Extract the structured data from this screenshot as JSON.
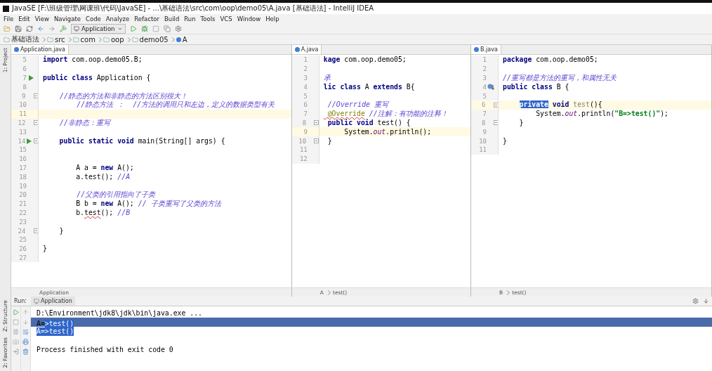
{
  "window": {
    "title": "JavaSE [F:\\班级管理\\网课班\\代码\\JavaSE] - ...\\基础语法\\src\\com\\oop\\demo05\\A.java [基础语法] - IntelliJ IDEA"
  },
  "menu": [
    "File",
    "Edit",
    "View",
    "Navigate",
    "Code",
    "Analyze",
    "Refactor",
    "Build",
    "Run",
    "Tools",
    "VCS",
    "Window",
    "Help"
  ],
  "toolbar": {
    "run_config": "Application"
  },
  "breadcrumb": [
    "基础语法",
    "src",
    "com",
    "oop",
    "demo05",
    "A"
  ],
  "side_tools": {
    "left_top": "1: Project",
    "left_bottom": [
      "Z: Structure",
      "2: Favorites"
    ]
  },
  "editors": [
    {
      "tab": "Application.java",
      "footer": [
        "Application"
      ],
      "lines": [
        {
          "n": "5",
          "current": false,
          "segs": [
            {
              "kind": "kw",
              "text": "import "
            },
            {
              "kind": "text",
              "text": "com.oop.demo05.B;"
            }
          ]
        },
        {
          "n": "6",
          "current": false
        },
        {
          "n": "7",
          "gutter": {
            "kind": "run"
          },
          "current": false,
          "segs": [
            {
              "kind": "kw",
              "text": "public class "
            },
            {
              "kind": "text",
              "text": "Application {"
            }
          ]
        },
        {
          "n": "8",
          "current": false
        },
        {
          "n": "9",
          "gutter": {
            "kind": "fold"
          },
          "current": false,
          "segs": [
            {
              "kind": "comment",
              "text": "    //静态的方法和非静态的方法区别很大！"
            }
          ]
        },
        {
          "n": "10",
          "current": false,
          "segs": [
            {
              "kind": "comment",
              "text": "        //静态方法 ：  //方法的调用只和左边，定义的数据类型有关"
            }
          ]
        },
        {
          "n": "11",
          "current": true
        },
        {
          "n": "12",
          "gutter": {
            "kind": "fold"
          },
          "current": false,
          "segs": [
            {
              "kind": "comment",
              "text": "    //非静态：重写"
            }
          ]
        },
        {
          "n": "13",
          "current": false
        },
        {
          "n": "14",
          "gutter": {
            "kind": "run-fold"
          },
          "current": false,
          "segs": [
            {
              "kind": "kw",
              "text": "    public static void "
            },
            {
              "kind": "text",
              "text": "main(String[] args) {"
            }
          ]
        },
        {
          "n": "15",
          "current": false
        },
        {
          "n": "16",
          "current": false
        },
        {
          "n": "17",
          "current": false,
          "segs": [
            {
              "kind": "text",
              "text": "        A a = "
            },
            {
              "kind": "kw",
              "text": "new "
            },
            {
              "kind": "text",
              "text": "A();"
            }
          ]
        },
        {
          "n": "18",
          "current": false,
          "segs": [
            {
              "kind": "text",
              "text": "        a.test(); "
            },
            {
              "kind": "comment",
              "text": "//A"
            }
          ]
        },
        {
          "n": "19",
          "current": false
        },
        {
          "n": "20",
          "current": false,
          "segs": [
            {
              "kind": "comment",
              "text": "        //父类的引用指向了子类"
            }
          ]
        },
        {
          "n": "21",
          "current": false,
          "segs": [
            {
              "kind": "text",
              "text": "        B b = "
            },
            {
              "kind": "kw",
              "text": "new "
            },
            {
              "kind": "text",
              "text": "A(); "
            },
            {
              "kind": "comment",
              "text": "// 子类重写了父类的方法"
            }
          ]
        },
        {
          "n": "22",
          "current": false,
          "segs": [
            {
              "kind": "text",
              "text": "        b."
            },
            {
              "kind": "text-squiggle",
              "text": "test"
            },
            {
              "kind": "text",
              "text": "(); "
            },
            {
              "kind": "comment",
              "text": "//B"
            }
          ]
        },
        {
          "n": "23",
          "current": false
        },
        {
          "n": "24",
          "gutter": {
            "kind": "fold"
          },
          "current": false,
          "segs": [
            {
              "kind": "text",
              "text": "    }"
            }
          ]
        },
        {
          "n": "25",
          "current": false
        },
        {
          "n": "26",
          "current": false,
          "segs": [
            {
              "kind": "text",
              "text": "}"
            }
          ]
        },
        {
          "n": "27",
          "current": false
        }
      ]
    },
    {
      "tab": "A.java",
      "footer": [
        "A",
        "test()"
      ],
      "lines": [
        {
          "n": "1",
          "current": false,
          "segs": [
            {
              "kind": "kw",
              "text": "kage "
            },
            {
              "kind": "text",
              "text": "com.oop.demo05;"
            }
          ]
        },
        {
          "n": "2",
          "current": false
        },
        {
          "n": "3",
          "current": false,
          "segs": [
            {
              "kind": "comment",
              "text": "承"
            }
          ]
        },
        {
          "n": "4",
          "current": false,
          "segs": [
            {
              "kind": "kw",
              "text": "lic class "
            },
            {
              "kind": "text",
              "text": "A "
            },
            {
              "kind": "kw",
              "text": "extends "
            },
            {
              "kind": "text",
              "text": "B{"
            }
          ]
        },
        {
          "n": "5",
          "current": false
        },
        {
          "n": "6",
          "current": false,
          "segs": [
            {
              "kind": "comment",
              "text": " //Override 重写"
            }
          ]
        },
        {
          "n": "7",
          "current": false,
          "segs": [
            {
              "kind": "annotation-squiggle",
              "text": " @Override"
            },
            {
              "kind": "comment",
              "text": " //注解：有功能的注释！"
            }
          ]
        },
        {
          "n": "8",
          "gutter": {
            "kind": "fold"
          },
          "current": false,
          "segs": [
            {
              "kind": "kw",
              "text": " public void "
            },
            {
              "kind": "text",
              "text": "test() {"
            }
          ]
        },
        {
          "n": "9",
          "current": true,
          "segs": [
            {
              "kind": "text",
              "text": "     System."
            },
            {
              "kind": "field",
              "text": "out"
            },
            {
              "kind": "text",
              "text": ".println();"
            }
          ]
        },
        {
          "n": "10",
          "gutter": {
            "kind": "fold"
          },
          "current": false,
          "segs": [
            {
              "kind": "text",
              "text": " }"
            }
          ]
        },
        {
          "n": "11",
          "current": false
        },
        {
          "n": "12",
          "current": false
        }
      ]
    },
    {
      "tab": "B.java",
      "footer": [
        "B",
        "test()"
      ],
      "lines": [
        {
          "n": "1",
          "current": false,
          "segs": [
            {
              "kind": "kw",
              "text": "package "
            },
            {
              "kind": "text",
              "text": "com.oop.demo05;"
            }
          ]
        },
        {
          "n": "2",
          "current": false
        },
        {
          "n": "3",
          "current": false,
          "segs": [
            {
              "kind": "comment",
              "text": "//重写都是方法的重写，和属性无关"
            }
          ]
        },
        {
          "n": "4",
          "gutter": {
            "kind": "impl"
          },
          "current": false,
          "segs": [
            {
              "kind": "kw",
              "text": "public class "
            },
            {
              "kind": "text",
              "text": "B {"
            }
          ]
        },
        {
          "n": "5",
          "current": false
        },
        {
          "n": "6",
          "gutter": {
            "kind": "fold"
          },
          "current": true,
          "segs": [
            {
              "kind": "kw-selected",
              "text": "    private"
            },
            {
              "kind": "kw",
              "text": " void "
            },
            {
              "kind": "unused",
              "text": "test"
            },
            {
              "kind": "text",
              "text": "(){"
            }
          ]
        },
        {
          "n": "7",
          "current": false,
          "segs": [
            {
              "kind": "text",
              "text": "        System."
            },
            {
              "kind": "field",
              "text": "out"
            },
            {
              "kind": "text",
              "text": ".println("
            },
            {
              "kind": "string",
              "text": "\"B=>test()\""
            },
            {
              "kind": "text",
              "text": ");"
            }
          ]
        },
        {
          "n": "8",
          "gutter": {
            "kind": "fold"
          },
          "current": false,
          "segs": [
            {
              "kind": "text",
              "text": "    }"
            }
          ]
        },
        {
          "n": "9",
          "current": false
        },
        {
          "n": "10",
          "current": false,
          "segs": [
            {
              "kind": "text",
              "text": "}"
            }
          ]
        },
        {
          "n": "11",
          "current": false
        }
      ]
    }
  ],
  "run_panel": {
    "label": "Run:",
    "tab": "Application",
    "console": [
      {
        "line_selected": false,
        "segs": [
          {
            "text": "D:\\Environment\\jdk8\\jdk\\bin\\java.exe ...",
            "selected": false
          }
        ]
      },
      {
        "line_selected": true,
        "segs": [
          {
            "text": "A=",
            "selected": false
          },
          {
            "text": ">test()",
            "selected": true
          }
        ]
      },
      {
        "line_selected": false,
        "segs": [
          {
            "text": "A=>test()",
            "selected": true
          }
        ]
      },
      {
        "line_selected": false
      },
      {
        "line_selected": false,
        "segs": [
          {
            "text": "Process finished with exit code 0",
            "selected": false
          }
        ]
      }
    ]
  }
}
